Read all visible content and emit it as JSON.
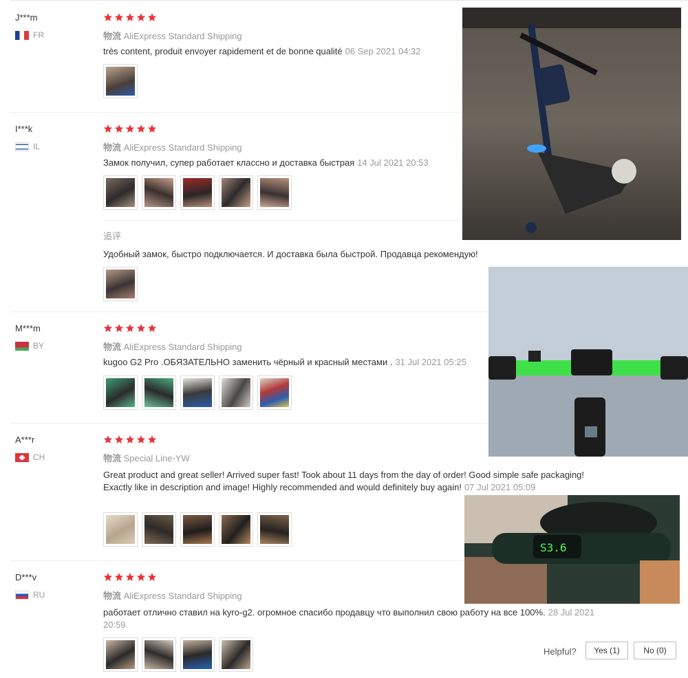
{
  "reviews": [
    {
      "user": "J***m",
      "country": "FR",
      "shipping_cn": "物流",
      "shipping": "AliExpress Standard Shipping",
      "text": "très content, produit envoyer rapidement et de bonne qualité",
      "date": "06 Sep 2021 04:32",
      "rating": 5
    },
    {
      "user": "I***k",
      "country": "IL",
      "shipping_cn": "物流",
      "shipping": "AliExpress Standard Shipping",
      "text": "Замок получил, супер работает классно и доставка быстрая",
      "date": "14 Jul 2021 20:53",
      "rating": 5,
      "additional_label": "追评",
      "additional_text": "Удобный замок, быстро подключается. И доставка была быстрой. Продавца рекомендую!"
    },
    {
      "user": "M***m",
      "country": "BY",
      "shipping_cn": "物流",
      "shipping": "AliExpress Standard Shipping",
      "text": "kugoo G2 Pro .ОБЯЗАТЕЛЬНО заменить чёрный и красный местами .",
      "date": "31 Jul 2021 05:25",
      "rating": 5
    },
    {
      "user": "A***r",
      "country": "CH",
      "shipping_cn": "物流",
      "shipping": "Special Line-YW",
      "text": "Great product and great seller! Arrived super fast! Took about 11 days from the day of order! Good simple safe packaging! Exactly like in description and image! Highly recommended and would definitely buy again!",
      "date": "07 Jul 2021 05:09",
      "rating": 5
    },
    {
      "user": "D***v",
      "country": "RU",
      "shipping_cn": "物流",
      "shipping": "AliExpress Standard Shipping",
      "text": "работает отлично ставил на kyro-g2. огромное спасибо продавцу что выполнил свою работу на все 100%.",
      "date": "28 Jul 2021 20:59",
      "rating": 5
    }
  ],
  "helpful": {
    "label": "Helpful?",
    "yes": "Yes (1)",
    "no": "No (0)"
  },
  "colors": {
    "star": "#e8333a",
    "muted": "#999999",
    "text": "#333333"
  }
}
